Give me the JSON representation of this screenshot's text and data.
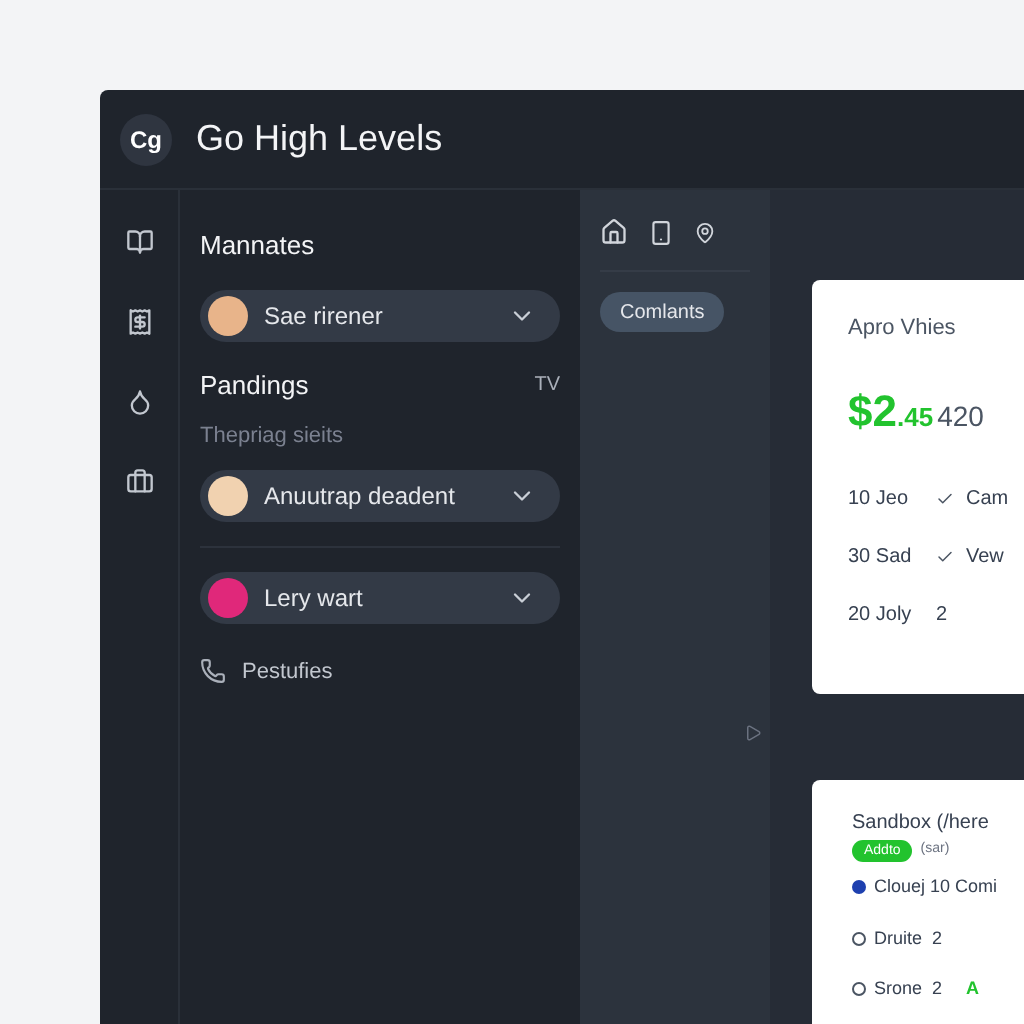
{
  "header": {
    "logo": "Cg",
    "title": "Go High Levels"
  },
  "sidebar": {
    "heading": "Mannates",
    "items": [
      {
        "kind": "select",
        "label": "Sae rirener",
        "color": "#e8b48a"
      },
      {
        "kind": "section",
        "label": "Pandings",
        "aside": "TV"
      },
      {
        "kind": "caption",
        "label": "Thepriag sieits"
      },
      {
        "kind": "select",
        "label": "Anuutrap deadent",
        "color": "#f1d2b0"
      },
      {
        "kind": "divider"
      },
      {
        "kind": "select",
        "label": "Lery wart",
        "color": "#e0287a"
      },
      {
        "kind": "link",
        "label": "Pestufies"
      }
    ]
  },
  "middle": {
    "button": "Comlants"
  },
  "card_1": {
    "title": "Apro Vhies",
    "amount_main": "$2",
    "amount_cents": ".45",
    "amount_rest": "420",
    "rows": [
      {
        "cells": [
          "10 Jeo",
          "Cam"
        ]
      },
      {
        "cells": [
          "30 Sad",
          "Vew"
        ]
      },
      {
        "cells": [
          "20 Joly",
          "2"
        ]
      }
    ]
  },
  "card_2": {
    "title": "Sandbox (/here",
    "badge": "Addto",
    "badge_note": "(sar)",
    "rows": [
      {
        "kind": "dot",
        "label": "Clouej 10 Comi"
      },
      {
        "kind": "g",
        "label": "Druite  2"
      },
      {
        "kind": "g",
        "label": "Srone  2",
        "extra": "A"
      }
    ]
  }
}
